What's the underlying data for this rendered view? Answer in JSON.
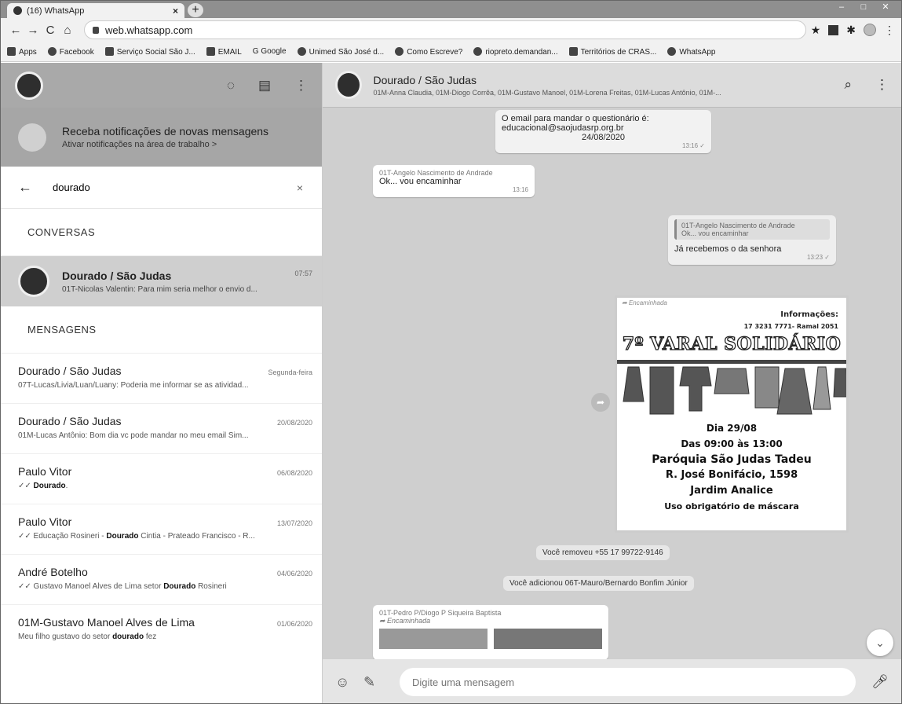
{
  "browser": {
    "tab_title": "(16) WhatsApp",
    "tab_close": "×",
    "new_tab": "+",
    "url": "web.whatsapp.com",
    "bookmarks": [
      "Apps",
      "Facebook",
      "Serviço Social São J...",
      "EMAIL",
      "Google",
      "Unimed São José d...",
      "Como Escreve?",
      "riopreto.demandan...",
      "Territórios de CRAS...",
      "WhatsApp"
    ]
  },
  "sidebar": {
    "notification": {
      "title": "Receba notificações de novas mensagens",
      "subtitle": "Ativar notificações na área de trabalho >"
    },
    "search": {
      "value": "dourado",
      "clear": "×"
    },
    "conversations_header": "CONVERSAS",
    "conversation": {
      "name": "Dourado / São Judas",
      "time": "07:57",
      "preview": "01T-Nicolas Valentin: Para mim seria melhor o envio d..."
    },
    "messages_header": "MENSAGENS",
    "messages": [
      {
        "name": "Dourado / São Judas",
        "time": "Segunda-feira",
        "preview": "07T-Lucas/Livia/Luan/Luany: Poderia me informar se as atividad..."
      },
      {
        "name": "Dourado / São Judas",
        "time": "20/08/2020",
        "preview": "01M-Lucas Antônio: Bom dia vc pode mandar no meu email Sim..."
      },
      {
        "name": "Paulo Vitor",
        "time": "06/08/2020",
        "preview_pre": "✓✓ ",
        "preview_bold": "Dourado",
        "preview_post": "."
      },
      {
        "name": "Paulo Vitor",
        "time": "13/07/2020",
        "preview_pre": "✓✓ Educação  Rosineri - ",
        "preview_bold": "Dourado",
        "preview_post": " Cintia - Prateado Francisco - R..."
      },
      {
        "name": "André Botelho",
        "time": "04/06/2020",
        "preview_pre": "✓✓ Gustavo Manoel Alves de Lima setor ",
        "preview_bold": "Dourado",
        "preview_post": " Rosineri"
      },
      {
        "name": "01M-Gustavo Manoel Alves de Lima",
        "time": "01/06/2020",
        "preview_pre": "Meu filho gustavo do setor ",
        "preview_bold": "dourado",
        "preview_post": " fez"
      }
    ]
  },
  "chat": {
    "name": "Dourado / São Judas",
    "members": "01M-Anna Claudia, 01M-Diogo Corrêa, 01M-Gustavo Manoel, 01M-Lorena Freitas, 01M-Lucas Antônio, 01M-...",
    "top_msg": "O email para mandar o questionário é: educacional@saojudasrp.org.br",
    "top_date": "24/08/2020",
    "top_time": "13:16 ✓",
    "in1": {
      "author": "01T-Angelo Nascimento de Andrade",
      "text": "Ok... vou encaminhar",
      "time": "13:16"
    },
    "out1": {
      "quote_author": "01T-Angelo Nascimento de Andrade",
      "quote_text": "Ok... vou encaminhar",
      "text": "Já recebemos o da senhora",
      "time": "13:23 ✓"
    },
    "poster": {
      "forwarded": "Encaminhada",
      "info1": "Informações:",
      "info2": "17 3231 7771- Ramal 2051",
      "title": "7º VARAL SOLIDÁRIO",
      "day": "Dia 29/08",
      "hours": "Das 09:00 às 13:00",
      "parish": "Paróquia São Judas Tadeu",
      "address": "R. José Bonifácio, 1598",
      "district": "Jardim Analice",
      "mask": "Uso obrigatório de máscara"
    },
    "sys1": "Você removeu +55 17 99722-9146",
    "sys2": "Você adicionou 06T-Mauro/Bernardo Bonfim Júnior",
    "in2": {
      "author": "01T-Pedro P/Diogo P Siqueira Baptista",
      "forwarded": "Encaminhada"
    },
    "compose_placeholder": "Digite uma mensagem"
  }
}
